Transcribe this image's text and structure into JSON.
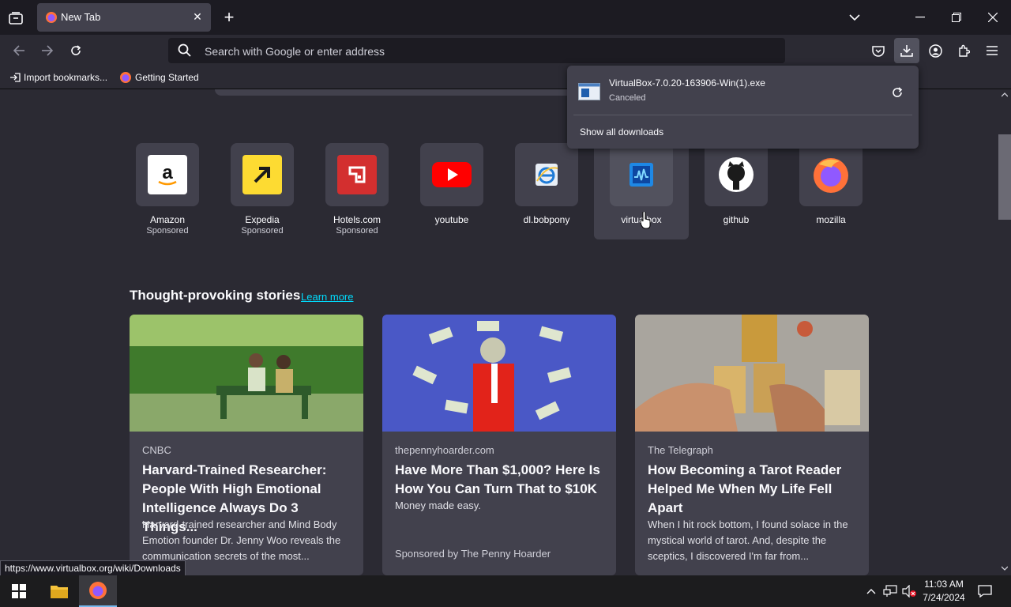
{
  "browser": {
    "tab": {
      "title": "New Tab"
    },
    "urlbar": {
      "placeholder": "Search with Google or enter address"
    },
    "bookmarks": [
      {
        "label": "Import bookmarks..."
      },
      {
        "label": "Getting Started"
      }
    ]
  },
  "downloads_panel": {
    "file_name": "VirtualBox-7.0.20-163906-Win(1).exe",
    "status": "Canceled",
    "show_all": "Show all downloads"
  },
  "top_sites": [
    {
      "name": "Amazon",
      "sponsored": "Sponsored"
    },
    {
      "name": "Expedia",
      "sponsored": "Sponsored"
    },
    {
      "name": "Hotels.com",
      "sponsored": "Sponsored"
    },
    {
      "name": "youtube"
    },
    {
      "name": "dl.bobpony"
    },
    {
      "name": "virtualbox"
    },
    {
      "name": "github"
    },
    {
      "name": "mozilla"
    }
  ],
  "stories": {
    "heading": "Thought-provoking stories",
    "learn_more": "Learn more",
    "cards": [
      {
        "source": "CNBC",
        "headline": "Harvard-Trained Researcher: People With High Emotional Intelligence Always Do 3 Things...",
        "excerpt": "Harvard-trained researcher and Mind Body Emotion founder Dr. Jenny Woo reveals the communication secrets of the most..."
      },
      {
        "source": "thepennyhoarder.com",
        "headline": "Have More Than $1,000? Here Is How You Can Turn That to $10K",
        "excerpt": "Money made easy.",
        "sponsor": "Sponsored by The Penny Hoarder"
      },
      {
        "source": "The Telegraph",
        "headline": "How Becoming a Tarot Reader Helped Me When My Life Fell Apart",
        "excerpt": "When I hit rock bottom, I found solace in the mystical world of tarot. And, despite the sceptics, I discovered I'm far from..."
      }
    ]
  },
  "status_link": "https://www.virtualbox.org/wiki/Downloads",
  "taskbar": {
    "time": "11:03 AM",
    "date": "7/24/2024"
  },
  "colors": {
    "accent_link": "#00ddff",
    "background": "#2b2a33",
    "tile": "#42414d"
  }
}
